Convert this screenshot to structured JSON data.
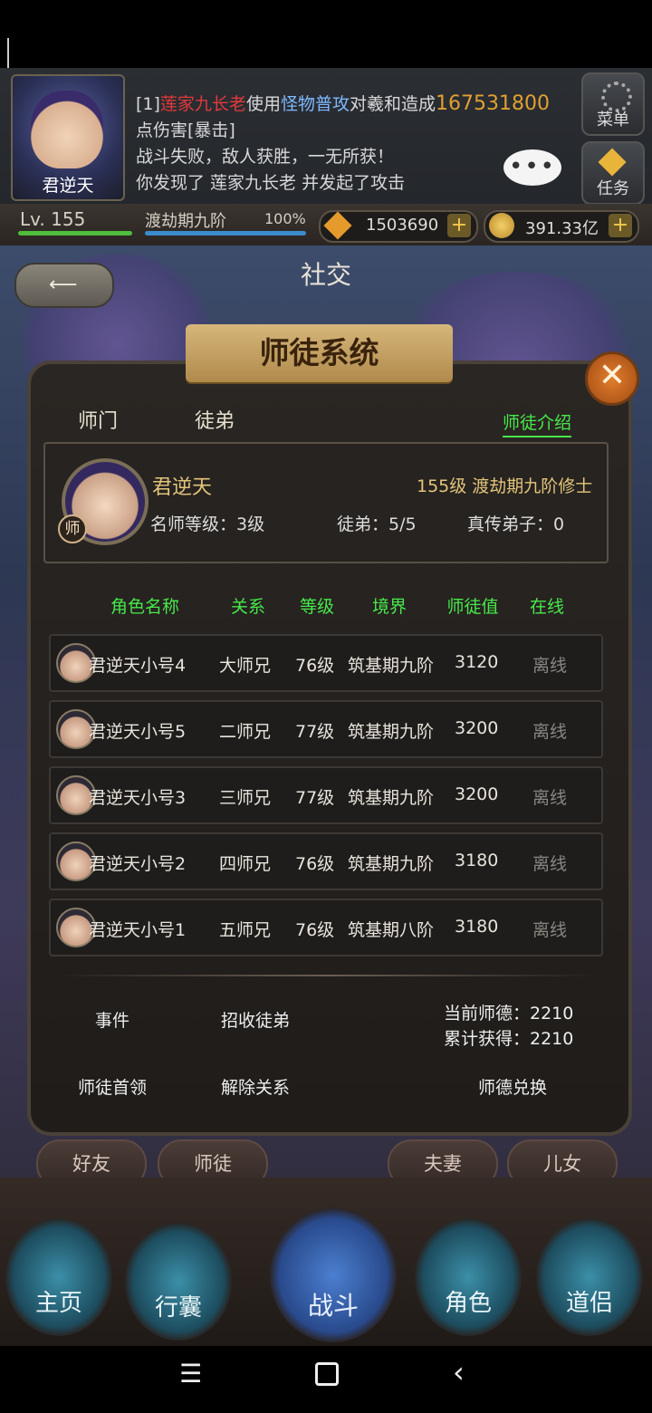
{
  "player": {
    "name": "君逆天",
    "level": "Lv. 155",
    "realm": "渡劫期九阶",
    "realm_progress": "100%",
    "diamonds": "1503690",
    "gold": "391.33亿"
  },
  "battle_log": {
    "line1_prefix": "[1]",
    "line1_enemy": "莲家九长老",
    "line1_mid": "使用",
    "line1_skill": "怪物普攻",
    "line1_to": "对",
    "line1_target": "羲和",
    "line1_action": "造成",
    "line1_damage": "167531800",
    "line2": "点伤害[暴击]",
    "line3": "战斗失败，敌人获胜，一无所获！",
    "line4": "你发现了 莲家九长老 并发起了攻击"
  },
  "chat_icon": "chat-bubble-icon",
  "side_buttons": {
    "menu": "菜单",
    "tasks": "任务"
  },
  "social_title": "社交",
  "modal": {
    "title": "师徒系统",
    "tabs": [
      "师门",
      "徒弟"
    ],
    "intro_link": "师徒介绍",
    "master": {
      "name": "君逆天",
      "level_title": "155级 渡劫期九阶修士",
      "badge": "师",
      "rank": "名师等级：3级",
      "disciples": "徒弟：5/5",
      "true_disciples": "真传弟子：0"
    },
    "columns": [
      "角色名称",
      "关系",
      "等级",
      "境界",
      "师徒值",
      "在线"
    ],
    "rows": [
      {
        "name": "君逆天小号4",
        "relation": "大师兄",
        "level": "76级",
        "realm": "筑基期九阶",
        "value": "3120",
        "online": "离线"
      },
      {
        "name": "君逆天小号5",
        "relation": "二师兄",
        "level": "77级",
        "realm": "筑基期九阶",
        "value": "3200",
        "online": "离线"
      },
      {
        "name": "君逆天小号3",
        "relation": "三师兄",
        "level": "77级",
        "realm": "筑基期九阶",
        "value": "3200",
        "online": "离线"
      },
      {
        "name": "君逆天小号2",
        "relation": "四师兄",
        "level": "76级",
        "realm": "筑基期九阶",
        "value": "3180",
        "online": "离线"
      },
      {
        "name": "君逆天小号1",
        "relation": "五师兄",
        "level": "76级",
        "realm": "筑基期八阶",
        "value": "3180",
        "online": "离线"
      }
    ],
    "actions": {
      "events": "事件",
      "recruit": "招收徒弟",
      "first": "师徒首领",
      "dissolve": "解除关系",
      "exchange": "师德兑换"
    },
    "balance": {
      "current": "当前师德：2210",
      "total": "累计获得：2210"
    }
  },
  "social_tabs": [
    "好友",
    "师徒",
    "夫妻",
    "儿女"
  ],
  "nav": [
    "主页",
    "行囊",
    "战斗",
    "角色",
    "道侣"
  ]
}
